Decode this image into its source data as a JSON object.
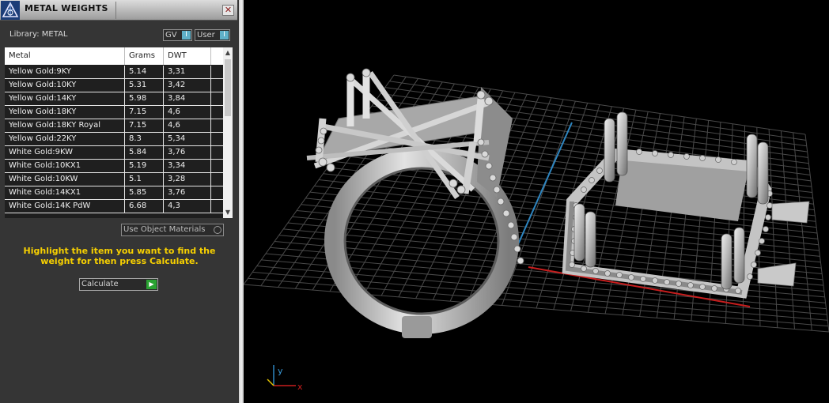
{
  "window": {
    "title": "METAL WEIGHTS",
    "close_glyph": "✕"
  },
  "library": {
    "label": "Library: METAL",
    "gv_toggle": "GV",
    "user_toggle": "User"
  },
  "table": {
    "headers": [
      "Metal",
      "Grams",
      "DWT"
    ],
    "rows": [
      {
        "metal": "Yellow Gold:9KY",
        "grams": "5.14",
        "dwt": "3,31"
      },
      {
        "metal": "Yellow Gold:10KY",
        "grams": "5.31",
        "dwt": "3,42"
      },
      {
        "metal": "Yellow Gold:14KY",
        "grams": "5.98",
        "dwt": "3,84"
      },
      {
        "metal": "Yellow Gold:18KY",
        "grams": "7.15",
        "dwt": "4,6"
      },
      {
        "metal": "Yellow Gold:18KY Royal",
        "grams": "7.15",
        "dwt": "4,6"
      },
      {
        "metal": "Yellow Gold:22KY",
        "grams": "8.3",
        "dwt": "5,34"
      },
      {
        "metal": "White Gold:9KW",
        "grams": "5.84",
        "dwt": "3,76"
      },
      {
        "metal": "White Gold:10KX1",
        "grams": "5.19",
        "dwt": "3,34"
      },
      {
        "metal": "White Gold:10KW",
        "grams": "5.1",
        "dwt": "3,28"
      },
      {
        "metal": "White Gold:14KX1",
        "grams": "5.85",
        "dwt": "3,76"
      },
      {
        "metal": "White Gold:14K PdW",
        "grams": "6.68",
        "dwt": "4,3"
      }
    ]
  },
  "use_object_materials": "Use Object Materials",
  "instructions": "Highlight the item you want to find the weight for then press Calculate.",
  "calculate_label": "Calculate",
  "axis": {
    "x_label": "x",
    "y_label": "y"
  },
  "colors": {
    "accent_toggle": "#5fb0c8",
    "instruction_text": "#f7d000",
    "calc_go": "#2aa232",
    "axis_x": "#c81e1e",
    "axis_y": "#2e86c1"
  },
  "icons": {
    "app_logo": "matrix-logo-icon",
    "close": "close-icon",
    "scroll_up": "chevron-up-icon",
    "scroll_down": "chevron-down-icon",
    "calculate_go": "play-icon"
  }
}
